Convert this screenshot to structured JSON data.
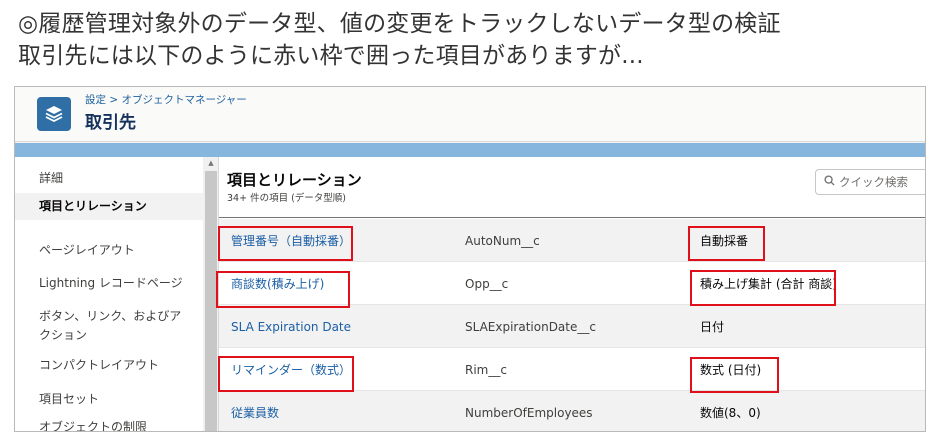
{
  "heading": {
    "line1": "◎履歴管理対象外のデータ型、値の変更をトラックしないデータ型の検証",
    "line2": "取引先には以下のように赤い枠で囲った項目がありますが..."
  },
  "header": {
    "icon": "layers-icon",
    "breadcrumb": "設定 > オブジェクトマネージャー",
    "title": "取引先"
  },
  "sidebar": {
    "items": [
      {
        "label": "詳細",
        "active": false
      },
      {
        "label": "項目とリレーション",
        "active": true
      },
      {
        "label": "ページレイアウト",
        "active": false
      },
      {
        "label": "Lightning レコードページ",
        "active": false
      },
      {
        "label": "ボタン、リンク、およびア",
        "label2": "クション",
        "active": false
      },
      {
        "label": "コンパクトレイアウト",
        "active": false
      },
      {
        "label": "項目セット",
        "active": false
      },
      {
        "label": "オブジェクトの制限",
        "active": false
      }
    ]
  },
  "main": {
    "title": "項目とリレーション",
    "subtitle": "34+ 件の項目 (データ型順)",
    "search_placeholder": "クイック検索",
    "rows": [
      {
        "label": "管理番号（自動採番）",
        "api": "AutoNum__c",
        "type": "自動採番",
        "highlight": true
      },
      {
        "label": "商談数(積み上げ)",
        "api": "Opp__c",
        "type": "積み上げ集計 (合計 商談)",
        "highlight": true
      },
      {
        "label": "SLA Expiration Date",
        "api": "SLAExpirationDate__c",
        "type": "日付",
        "highlight": false
      },
      {
        "label": "リマインダー（数式）",
        "api": "Rim__c",
        "type": "数式 (日付)",
        "highlight": true
      },
      {
        "label": "従業員数",
        "api": "NumberOfEmployees",
        "type": "数値(8、0)",
        "highlight": false
      }
    ]
  },
  "colors": {
    "highlight": "#e0101a",
    "link": "#1b5fa5",
    "banner": "#86b5dd",
    "icon_bg": "#2f6fa6"
  }
}
